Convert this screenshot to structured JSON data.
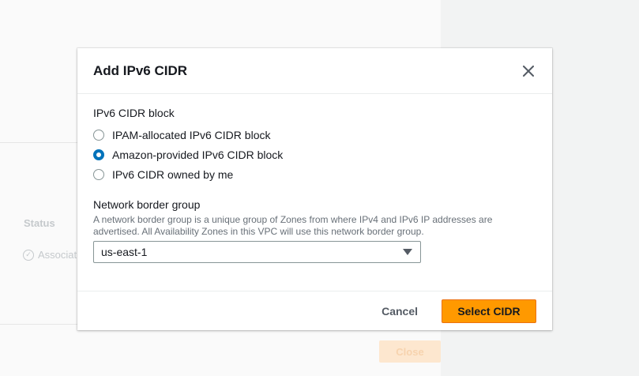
{
  "background": {
    "status_label": "Status",
    "association_value": "Associat",
    "close_button_label": "Close"
  },
  "modal": {
    "title": "Add IPv6 CIDR",
    "close_icon": "close-icon",
    "cidr_block": {
      "label": "IPv6 CIDR block",
      "options": [
        {
          "label": "IPAM-allocated IPv6 CIDR block",
          "checked": false
        },
        {
          "label": "Amazon-provided IPv6 CIDR block",
          "checked": true
        },
        {
          "label": "IPv6 CIDR owned by me",
          "checked": false
        }
      ]
    },
    "network_border_group": {
      "label": "Network border group",
      "description": "A network border group is a unique group of Zones from where IPv4 and IPv6 IP addresses are advertised. All Availability Zones in this VPC will use this network border group.",
      "selected": "us-east-1"
    },
    "footer": {
      "cancel_label": "Cancel",
      "primary_label": "Select CIDR"
    }
  },
  "colors": {
    "accent_radio": "#0073bb",
    "primary_button": "#ff9900",
    "text": "#16191f",
    "muted_text": "#687078"
  }
}
